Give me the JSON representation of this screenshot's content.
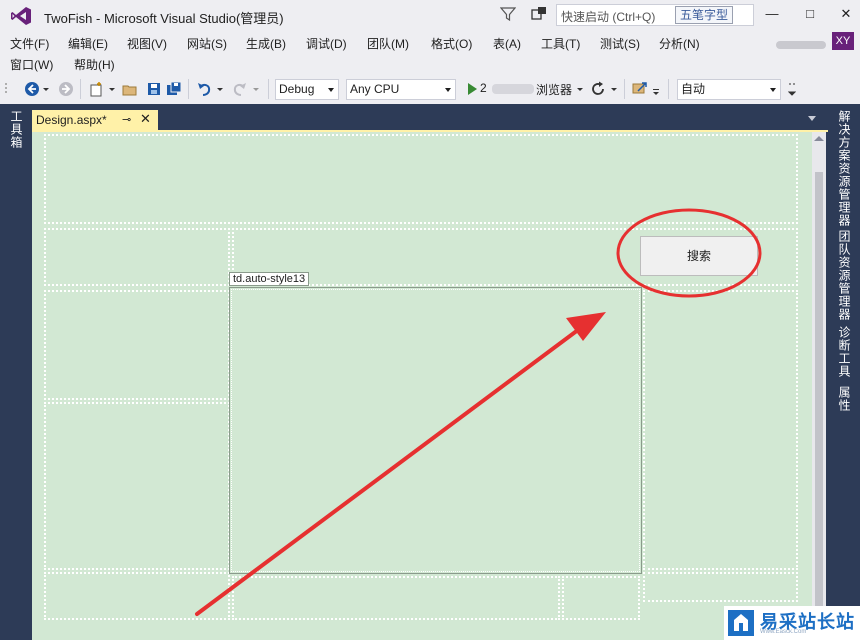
{
  "window": {
    "title": "TwoFish - Microsoft Visual Studio(管理员)",
    "quick_launch_placeholder": "快速启动 (Ctrl+Q)",
    "ime_badge": "五笔字型",
    "avatar_initials": "XY",
    "minimize": "—",
    "maximize": "□",
    "close": "✕"
  },
  "menu": {
    "items": [
      "文件(F)",
      "编辑(E)",
      "视图(V)",
      "网站(S)",
      "生成(B)",
      "调试(D)",
      "团队(M)",
      "格式(O)",
      "表(A)",
      "工具(T)",
      "测试(S)",
      "分析(N)"
    ],
    "row2": [
      "窗口(W)",
      "帮助(H)"
    ]
  },
  "toolbar": {
    "config": "Debug",
    "platform": "Any CPU",
    "run_prefix": "2",
    "run_suffix": "浏览器",
    "target_view": "自动"
  },
  "left_dock": {
    "toolbox": "工具箱"
  },
  "right_dock": {
    "solution_explorer": "解决方案资源管理器",
    "team_explorer": "团队资源管理器",
    "diagnostics": "诊断工具",
    "properties": "属性"
  },
  "document": {
    "tab_label": "Design.aspx*",
    "pin_glyph": "⊸",
    "close_glyph": "✕",
    "cell_tag": "td.auto-style13",
    "search_button": "搜索"
  },
  "watermark": {
    "text": "易采站长站",
    "subtext": "Www.Easck.Com"
  },
  "colors": {
    "design_bg": "#d2e8d3",
    "dock_bg": "#2d3b57",
    "tab_active": "#fff1a8",
    "annotation": "#e63030",
    "accent": "#68217a"
  }
}
